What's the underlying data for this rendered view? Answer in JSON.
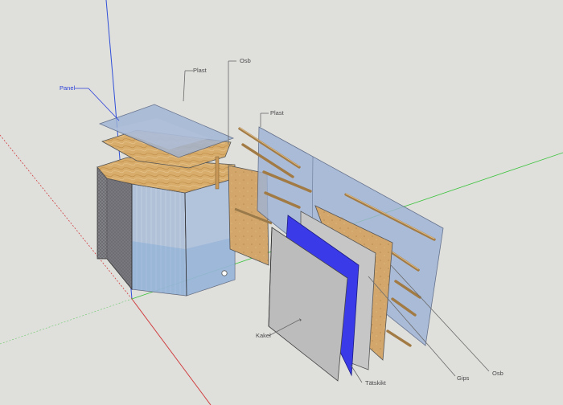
{
  "scene": {
    "labels": {
      "panel": "Panel",
      "plast_top": "Plast",
      "osb_top": "Osb",
      "plast_wall": "Plast",
      "kakel": "Kakel",
      "tatskikt": "Tätskikt",
      "gips": "Gips",
      "osb_bottom": "Osb"
    },
    "colors": {
      "background": "#dfdfdc",
      "plastic": "#9fb4d6",
      "osb": "#d4a868",
      "gypsum": "#c6c6c6",
      "membrane": "#3a3ae8",
      "tile": "#bcbcbc",
      "axis_red": "#d04040",
      "axis_green": "#3cc43c",
      "axis_blue": "#3050d8"
    }
  }
}
